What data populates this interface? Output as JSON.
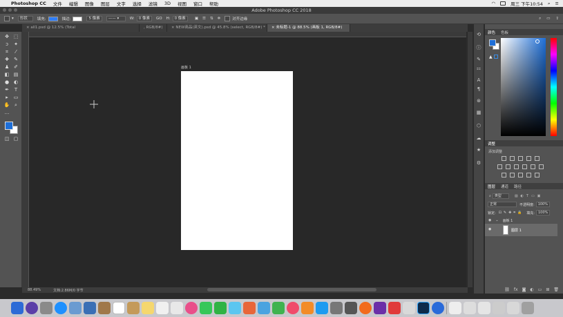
{
  "menubar": {
    "apple_glyph": "",
    "app_name": "Photoshop CC",
    "items": [
      "文件",
      "编辑",
      "图像",
      "图层",
      "文字",
      "选择",
      "滤镜",
      "3D",
      "视图",
      "窗口",
      "帮助"
    ],
    "clock": "周三 下午10:54"
  },
  "window": {
    "title": "Adobe Photoshop CC 2018"
  },
  "options": {
    "shape_mode": "形状",
    "fill_label": "填充:",
    "stroke_label": "描边:",
    "stroke_width": "5 像素",
    "w_label": "W:",
    "w_value": "0 像素",
    "go_label": "GO",
    "h_label": "H:",
    "h_value": "0 像素",
    "align_edges_label": "对齐边缘",
    "fill_color": "#2f7df6"
  },
  "tabs": [
    {
      "label": "all1.psd @ 12.5% (Total"
    },
    {
      "label": ", RGB/8#)"
    },
    {
      "label": "NEW商品(英文).psd @ 45.8% (select, RGB/8#) *"
    },
    {
      "label": "未标题-1 @ 88.5% (画板 1, RGB/8#)"
    }
  ],
  "artboard": {
    "label": "画板 1"
  },
  "status": {
    "zoom": "88.49%",
    "doc": "文档:2.86M/0 字节"
  },
  "colors": {
    "foreground": "#1e6fd8",
    "background": "#ffffff"
  },
  "color_panel": {
    "tabs": [
      "颜色",
      "色板"
    ]
  },
  "adjust_panel": {
    "title": "调整",
    "subtitle": "添加调整"
  },
  "layers_panel": {
    "tabs": [
      "图层",
      "通道",
      "路径"
    ],
    "filter": "类型",
    "blend": "正常",
    "opacity_label": "不透明度:",
    "opacity": "100%",
    "lock_label": "锁定:",
    "fill_label": "填充:",
    "fill": "100%",
    "artboard_name": "画板 1",
    "layer_name": "图层 1"
  }
}
